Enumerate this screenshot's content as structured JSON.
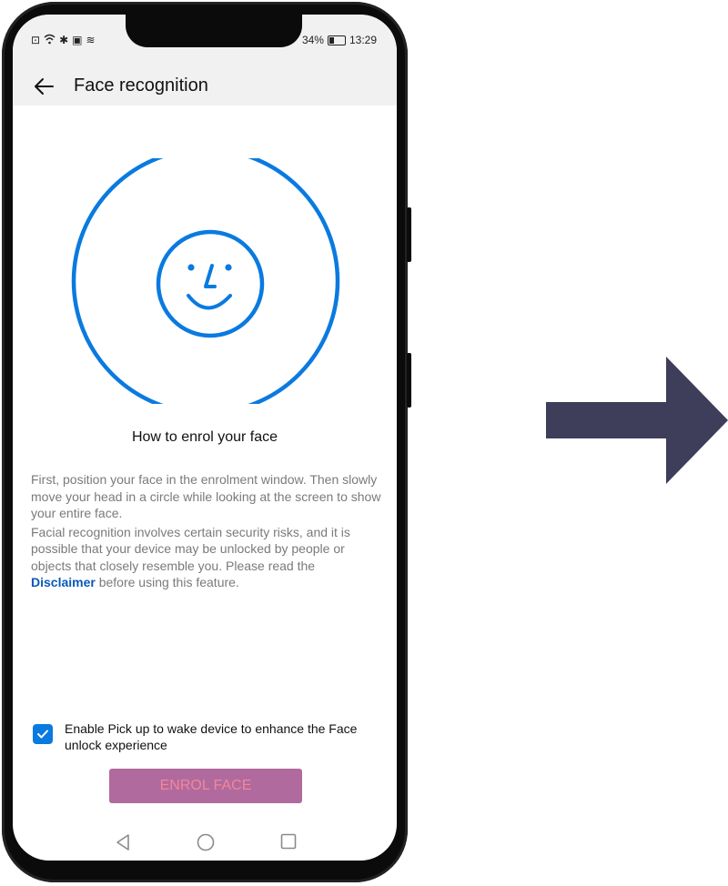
{
  "status": {
    "battery": "34%",
    "time": "13:29",
    "left_icons": [
      "alert-icon",
      "wifi-icon",
      "bluetooth-icon",
      "calendar-icon",
      "nfc-icon"
    ]
  },
  "appbar": {
    "title": "Face recognition"
  },
  "heading": "How to enrol your face",
  "description": {
    "para1": "First, position your face in the enrolment window. Then slowly move your head in a circle while looking at the screen to show your entire face.",
    "para2_before": "Facial recognition involves certain security risks, and it is possible that your device may be unlocked by people or objects that closely resemble you. Please read the ",
    "link": "Disclaimer",
    "para2_after": " before using this feature."
  },
  "checkbox": {
    "checked": true,
    "label": "Enable Pick up to wake device to enhance the Face unlock experience"
  },
  "enrol_button": "ENROL FACE",
  "colors": {
    "accent_blue": "#0a7ae0",
    "link_blue": "#0a59b8",
    "button_bg": "#b16a9d",
    "button_text": "#f2879a",
    "arrow": "#3e3d5a"
  }
}
